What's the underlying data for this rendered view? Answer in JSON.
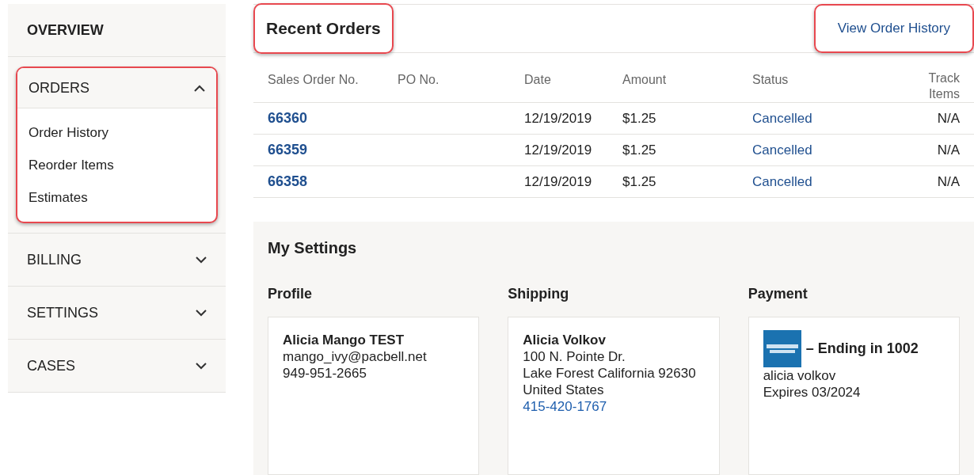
{
  "sidebar": {
    "items": [
      {
        "label": "OVERVIEW",
        "kind": "link",
        "highlighted": false
      },
      {
        "label": "ORDERS",
        "kind": "section",
        "expanded": true,
        "highlighted": true,
        "children": [
          {
            "label": "Order History"
          },
          {
            "label": "Reorder Items"
          },
          {
            "label": "Estimates"
          }
        ]
      },
      {
        "label": "BILLING",
        "kind": "section",
        "expanded": false,
        "highlighted": false
      },
      {
        "label": "SETTINGS",
        "kind": "section",
        "expanded": false,
        "highlighted": false
      },
      {
        "label": "CASES",
        "kind": "section",
        "expanded": false,
        "highlighted": false
      }
    ]
  },
  "recent_orders": {
    "title": "Recent Orders",
    "title_highlighted": true,
    "link": "View Order History",
    "link_highlighted": true,
    "columns": [
      "Sales Order No.",
      "PO No.",
      "Date",
      "Amount",
      "Status",
      "Track Items"
    ],
    "rows": [
      {
        "order_no": "66360",
        "date": "12/19/2019",
        "amount": "$1.25",
        "status": "Cancelled",
        "track": "N/A"
      },
      {
        "order_no": "66359",
        "date": "12/19/2019",
        "amount": "$1.25",
        "status": "Cancelled",
        "track": "N/A"
      },
      {
        "order_no": "66358",
        "date": "12/19/2019",
        "amount": "$1.25",
        "status": "Cancelled",
        "track": "N/A"
      }
    ]
  },
  "settings": {
    "title": "My Settings",
    "profile": {
      "heading": "Profile",
      "name": "Alicia Mango TEST",
      "email": "mango_ivy@pacbell.net",
      "phone": "949-951-2665"
    },
    "shipping": {
      "heading": "Shipping",
      "name": "Alicia Volkov",
      "lines": [
        "100 N. Pointe Dr.",
        "Lake Forest California 92630",
        "United States"
      ],
      "phone": "415-420-1767"
    },
    "payment": {
      "heading": "Payment",
      "card": "– Ending in 1002",
      "holder": "alicia volkov",
      "expires": "Expires 03/2024"
    }
  }
}
